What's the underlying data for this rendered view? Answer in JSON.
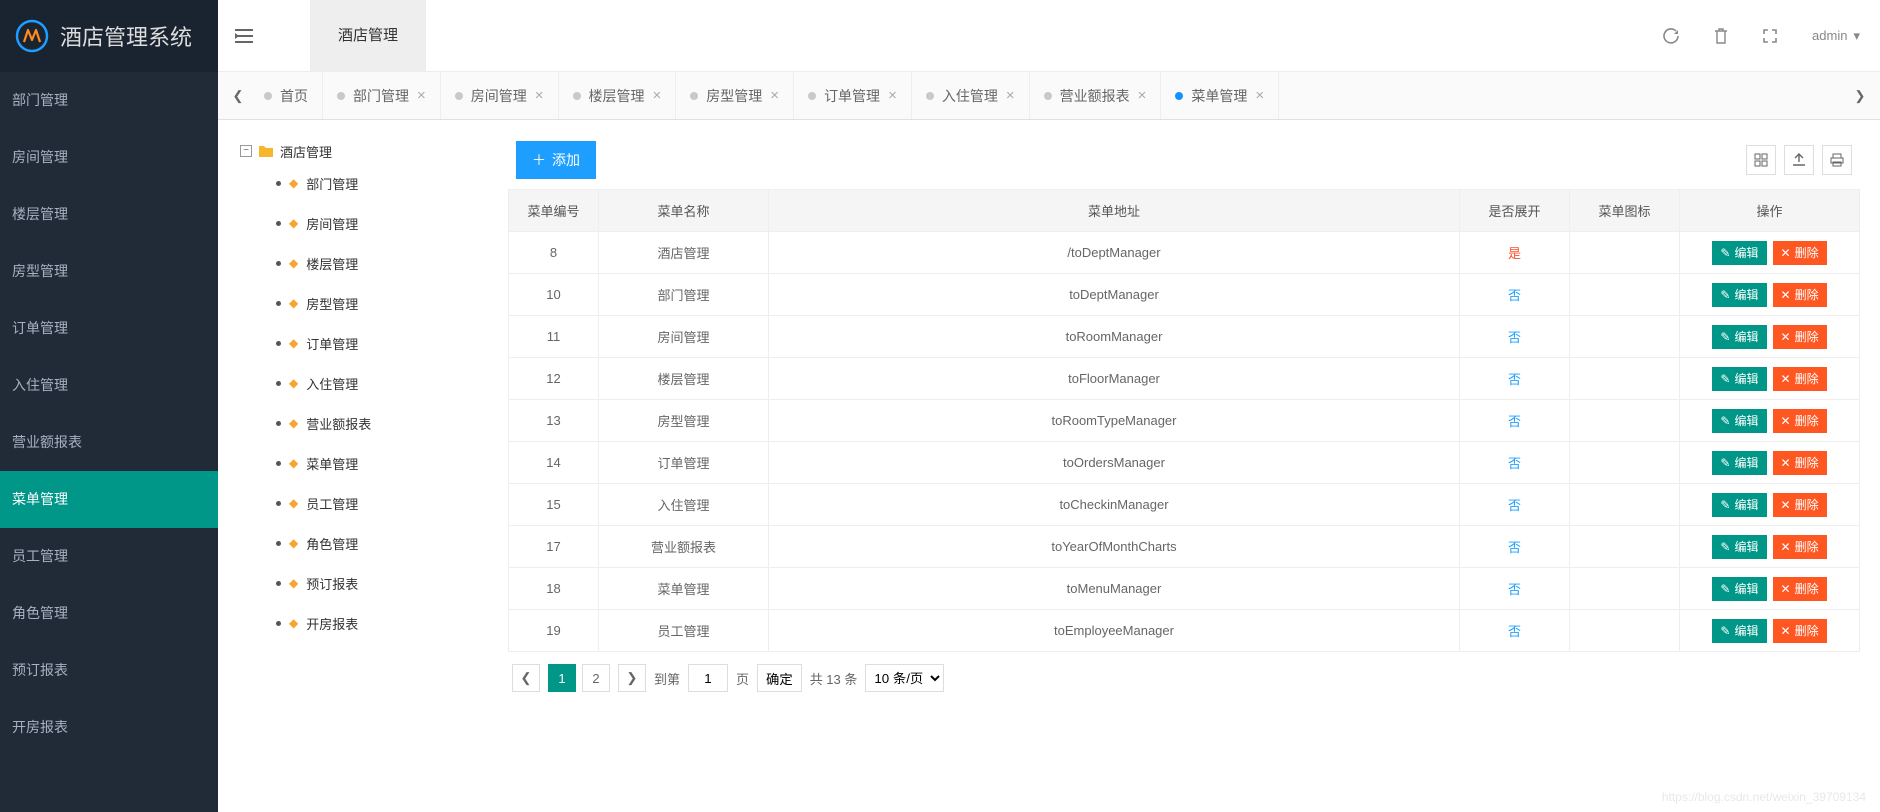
{
  "app_title": "酒店管理系统",
  "sidebar": {
    "items": [
      {
        "label": "部门管理"
      },
      {
        "label": "房间管理"
      },
      {
        "label": "楼层管理"
      },
      {
        "label": "房型管理"
      },
      {
        "label": "订单管理"
      },
      {
        "label": "入住管理"
      },
      {
        "label": "营业额报表"
      },
      {
        "label": "菜单管理",
        "active": true
      },
      {
        "label": "员工管理"
      },
      {
        "label": "角色管理"
      },
      {
        "label": "预订报表"
      },
      {
        "label": "开房报表"
      }
    ]
  },
  "topbar": {
    "main_tab": "酒店管理",
    "user_label": "admin"
  },
  "tabs": [
    {
      "label": "首页",
      "closable": false
    },
    {
      "label": "部门管理",
      "closable": true
    },
    {
      "label": "房间管理",
      "closable": true
    },
    {
      "label": "楼层管理",
      "closable": true
    },
    {
      "label": "房型管理",
      "closable": true
    },
    {
      "label": "订单管理",
      "closable": true
    },
    {
      "label": "入住管理",
      "closable": true
    },
    {
      "label": "营业额报表",
      "closable": true
    },
    {
      "label": "菜单管理",
      "closable": true,
      "current": true
    }
  ],
  "tree": {
    "root_label": "酒店管理",
    "children": [
      {
        "label": "部门管理"
      },
      {
        "label": "房间管理"
      },
      {
        "label": "楼层管理"
      },
      {
        "label": "房型管理"
      },
      {
        "label": "订单管理"
      },
      {
        "label": "入住管理"
      },
      {
        "label": "营业额报表"
      },
      {
        "label": "菜单管理"
      },
      {
        "label": "员工管理"
      },
      {
        "label": "角色管理"
      },
      {
        "label": "预订报表"
      },
      {
        "label": "开房报表"
      }
    ]
  },
  "buttons": {
    "add": "添加",
    "edit": "编辑",
    "delete": "删除"
  },
  "table": {
    "headers": [
      "菜单编号",
      "菜单名称",
      "菜单地址",
      "是否展开",
      "菜单图标",
      "操作"
    ],
    "rows": [
      {
        "id": "8",
        "name": "酒店管理",
        "url": "/toDeptManager",
        "expand": "是"
      },
      {
        "id": "10",
        "name": "部门管理",
        "url": "toDeptManager",
        "expand": "否"
      },
      {
        "id": "11",
        "name": "房间管理",
        "url": "toRoomManager",
        "expand": "否"
      },
      {
        "id": "12",
        "name": "楼层管理",
        "url": "toFloorManager",
        "expand": "否"
      },
      {
        "id": "13",
        "name": "房型管理",
        "url": "toRoomTypeManager",
        "expand": "否"
      },
      {
        "id": "14",
        "name": "订单管理",
        "url": "toOrdersManager",
        "expand": "否"
      },
      {
        "id": "15",
        "name": "入住管理",
        "url": "toCheckinManager",
        "expand": "否"
      },
      {
        "id": "17",
        "name": "营业额报表",
        "url": "toYearOfMonthCharts",
        "expand": "否"
      },
      {
        "id": "18",
        "name": "菜单管理",
        "url": "toMenuManager",
        "expand": "否"
      },
      {
        "id": "19",
        "name": "员工管理",
        "url": "toEmployeeManager",
        "expand": "否"
      }
    ]
  },
  "pager": {
    "pages": [
      "1",
      "2"
    ],
    "current": "1",
    "goto_prefix": "到第",
    "goto_value": "1",
    "goto_suffix": "页",
    "confirm": "确定",
    "total": "共 13 条",
    "per_page": "10 条/页"
  },
  "watermark": "https://blog.csdn.net/weixin_39709134"
}
